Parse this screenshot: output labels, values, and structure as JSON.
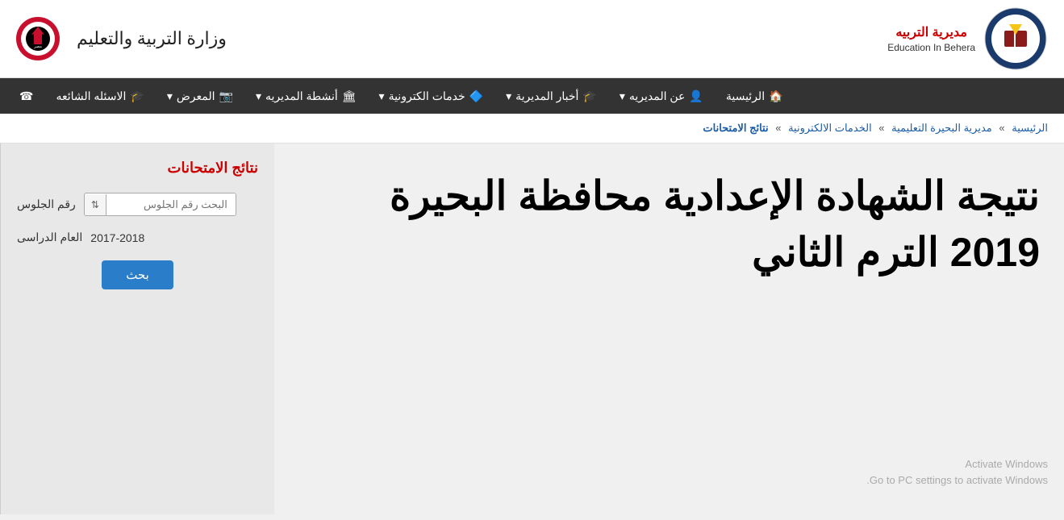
{
  "header": {
    "brand_name": "مديرية التربيه",
    "brand_sub": "Education In Behera",
    "ministry_text": "وزارة التربية والتعليم",
    "egypt_label": "جمهورية مصر العربية"
  },
  "navbar": {
    "items": [
      {
        "label": "الرئيسية",
        "icon": "🏠"
      },
      {
        "label": "عن المديريه",
        "icon": "👤",
        "has_dropdown": true
      },
      {
        "label": "أخبار المديرية",
        "icon": "🎓",
        "has_dropdown": true
      },
      {
        "label": "خدمات الكترونية",
        "icon": "🔷",
        "has_dropdown": true
      },
      {
        "label": "أنشطة المديريه",
        "icon": "🏛",
        "has_dropdown": true
      },
      {
        "label": "المعرض",
        "icon": "📷",
        "has_dropdown": true
      },
      {
        "label": "الاسئله الشائعه",
        "icon": "🎓"
      },
      {
        "label": "☎",
        "icon": ""
      }
    ]
  },
  "breadcrumb": {
    "items": [
      {
        "label": "الرئيسية",
        "link": true
      },
      {
        "label": "مديرية البحيرة التعليمية",
        "link": true
      },
      {
        "label": "الخدمات الالكترونية",
        "link": true
      },
      {
        "label": "نتائج الامتحانات",
        "link": true,
        "active": true
      }
    ],
    "separator": "»"
  },
  "main": {
    "title_line1": "نتيجة الشهادة الإعدادية محافظة البحيرة",
    "title_line2": "2019 الترم الثاني",
    "sidebar_title": "نتائج الامتحانات",
    "seat_number_label": "رقم الجلوس",
    "seat_number_placeholder": "البحث رقم الجلوس",
    "academic_year_label": "العام الدراسى",
    "academic_year_value": "2017-2018",
    "search_button": "بحث"
  },
  "activate_windows": {
    "line1": "Activate Windows",
    "line2": "Go to PC settings to activate Windows."
  }
}
